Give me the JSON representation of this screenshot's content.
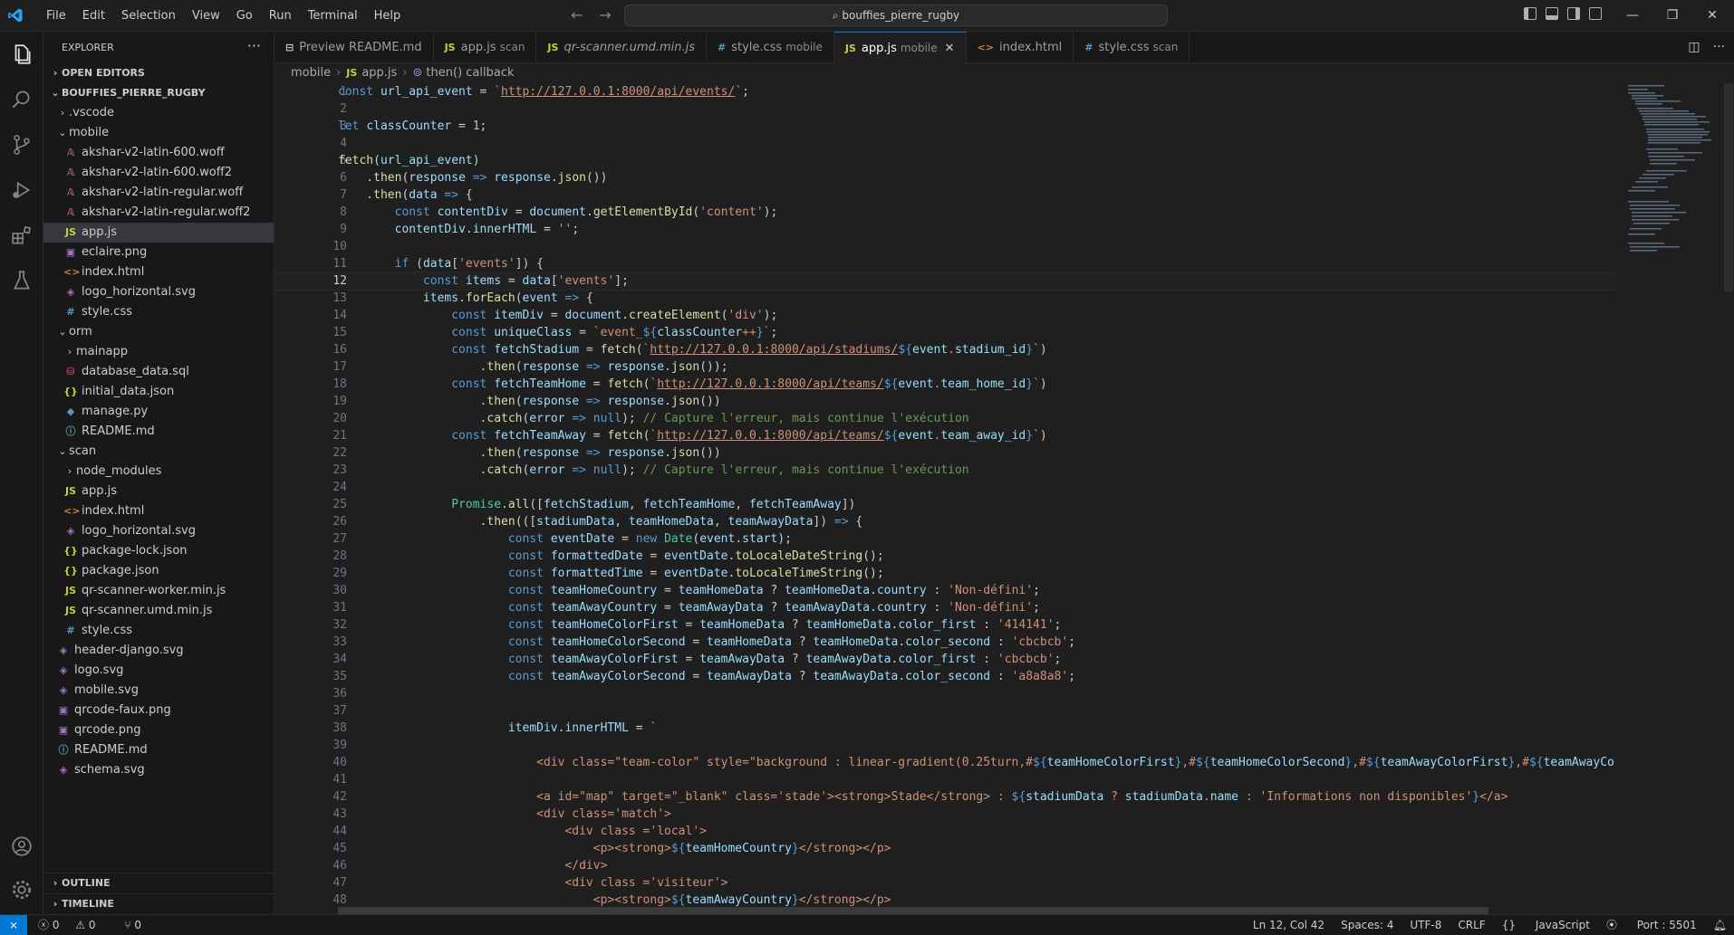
{
  "menu": [
    "File",
    "Edit",
    "Selection",
    "View",
    "Go",
    "Run",
    "Terminal",
    "Help"
  ],
  "command_center": "bouffies_pierre_rugby",
  "explorer": {
    "title": "EXPLORER",
    "open_editors": "OPEN EDITORS",
    "project": "BOUFFIES_PIERRE_RUGBY",
    "items": [
      {
        "label": ".vscode",
        "type": "folder",
        "depth": 1,
        "open": false
      },
      {
        "label": "mobile",
        "type": "folder",
        "depth": 1,
        "open": true
      },
      {
        "label": "akshar-v2-latin-600.woff",
        "type": "font",
        "depth": 2
      },
      {
        "label": "akshar-v2-latin-600.woff2",
        "type": "font",
        "depth": 2
      },
      {
        "label": "akshar-v2-latin-regular.woff",
        "type": "font",
        "depth": 2
      },
      {
        "label": "akshar-v2-latin-regular.woff2",
        "type": "font",
        "depth": 2
      },
      {
        "label": "app.js",
        "type": "js",
        "depth": 2,
        "selected": true
      },
      {
        "label": "eclaire.png",
        "type": "image",
        "depth": 2
      },
      {
        "label": "index.html",
        "type": "html",
        "depth": 2
      },
      {
        "label": "logo_horizontal.svg",
        "type": "svg",
        "depth": 2
      },
      {
        "label": "style.css",
        "type": "css",
        "depth": 2
      },
      {
        "label": "orm",
        "type": "folder",
        "depth": 1,
        "open": true
      },
      {
        "label": "mainapp",
        "type": "folder",
        "depth": 2,
        "open": false
      },
      {
        "label": "database_data.sql",
        "type": "sql",
        "depth": 2
      },
      {
        "label": "initial_data.json",
        "type": "json",
        "depth": 2
      },
      {
        "label": "manage.py",
        "type": "py",
        "depth": 2
      },
      {
        "label": "README.md",
        "type": "md",
        "depth": 2
      },
      {
        "label": "scan",
        "type": "folder",
        "depth": 1,
        "open": true
      },
      {
        "label": "node_modules",
        "type": "folder",
        "depth": 2,
        "open": false
      },
      {
        "label": "app.js",
        "type": "js",
        "depth": 2
      },
      {
        "label": "index.html",
        "type": "html",
        "depth": 2
      },
      {
        "label": "logo_horizontal.svg",
        "type": "svg",
        "depth": 2
      },
      {
        "label": "package-lock.json",
        "type": "json",
        "depth": 2
      },
      {
        "label": "package.json",
        "type": "json",
        "depth": 2
      },
      {
        "label": "qr-scanner-worker.min.js",
        "type": "js",
        "depth": 2
      },
      {
        "label": "qr-scanner.umd.min.js",
        "type": "js",
        "depth": 2
      },
      {
        "label": "style.css",
        "type": "css",
        "depth": 2
      },
      {
        "label": "header-django.svg",
        "type": "svg",
        "depth": 1
      },
      {
        "label": "logo.svg",
        "type": "svg",
        "depth": 1
      },
      {
        "label": "mobile.svg",
        "type": "svg",
        "depth": 1
      },
      {
        "label": "qrcode-faux.png",
        "type": "image",
        "depth": 1
      },
      {
        "label": "qrcode.png",
        "type": "image",
        "depth": 1
      },
      {
        "label": "README.md",
        "type": "md",
        "depth": 1
      },
      {
        "label": "schema.svg",
        "type": "svg",
        "depth": 1
      }
    ],
    "outline": "OUTLINE",
    "timeline": "TIMELINE"
  },
  "tabs": [
    {
      "icon": "preview",
      "label": "Preview README.md",
      "desc": ""
    },
    {
      "icon": "js",
      "label": "app.js",
      "desc": "scan"
    },
    {
      "icon": "js",
      "label": "qr-scanner.umd.min.js",
      "desc": "",
      "italic": true
    },
    {
      "icon": "css",
      "label": "style.css",
      "desc": "mobile"
    },
    {
      "icon": "js",
      "label": "app.js",
      "desc": "mobile",
      "active": true
    },
    {
      "icon": "html",
      "label": "index.html",
      "desc": ""
    },
    {
      "icon": "css",
      "label": "style.css",
      "desc": "scan"
    }
  ],
  "breadcrumb": [
    "mobile",
    "app.js",
    "then() callback"
  ],
  "status": {
    "problems": "0",
    "warnings": "0",
    "ports": "0",
    "position": "Ln 12, Col 42",
    "spaces": "Spaces: 4",
    "encoding": "UTF-8",
    "eol": "CRLF",
    "language": "JavaScript",
    "port": "Port : 5501"
  },
  "colors": {
    "accent": "#0078d4",
    "editor_bg": "#1f1f1f",
    "sidebar_bg": "#181818"
  },
  "current_line": 12
}
